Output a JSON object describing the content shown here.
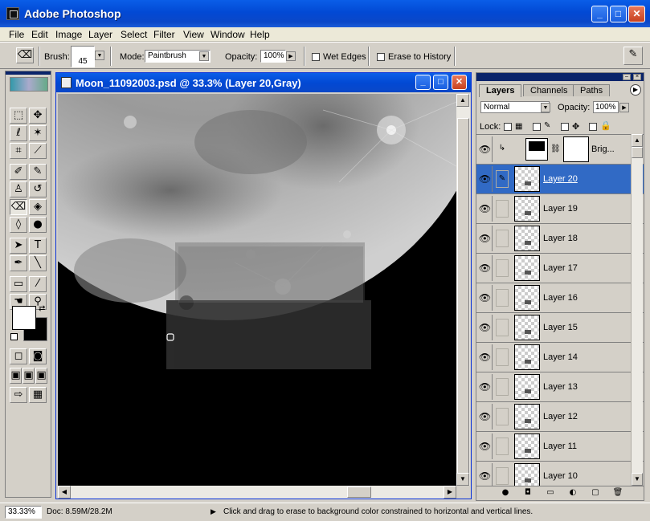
{
  "app": {
    "title": "Adobe Photoshop"
  },
  "menu": [
    "File",
    "Edit",
    "Image",
    "Layer",
    "Select",
    "Filter",
    "View",
    "Window",
    "Help"
  ],
  "options": {
    "brush_label": "Brush:",
    "brush_size": "45",
    "mode_label": "Mode:",
    "mode_value": "Paintbrush",
    "opacity_label": "Opacity:",
    "opacity_value": "100%",
    "wet_edges": "Wet Edges",
    "erase_history": "Erase to History"
  },
  "document": {
    "title": "Moon_11092003.psd @ 33.3% (Layer 20,Gray)"
  },
  "layers_panel": {
    "tabs": [
      "Layers",
      "Channels",
      "Paths"
    ],
    "blend_mode": "Normal",
    "opacity_label": "Opacity:",
    "opacity_value": "100%",
    "lock_label": "Lock:",
    "adjustment_layer": "Brig...",
    "layers": [
      "Layer 20",
      "Layer 19",
      "Layer 18",
      "Layer 17",
      "Layer 16",
      "Layer 15",
      "Layer 14",
      "Layer 13",
      "Layer 12",
      "Layer 11",
      "Layer 10"
    ]
  },
  "status": {
    "zoom": "33.33%",
    "doc_info": "Doc: 8.59M/28.2M",
    "hint": "Click and drag to erase to background color constrained to horizontal and vertical lines."
  },
  "colors": {
    "titlebar": "#0a5ee8",
    "selected_layer": "#316ac5",
    "chrome": "#d4d0c8"
  }
}
